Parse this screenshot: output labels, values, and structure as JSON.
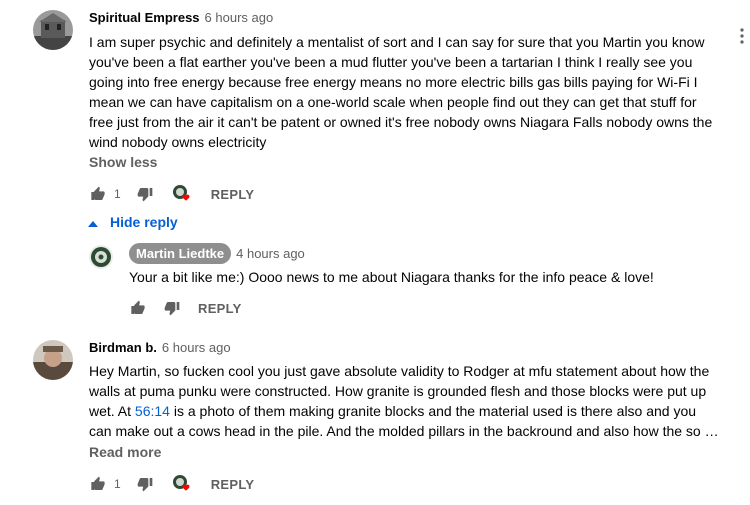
{
  "comments": [
    {
      "author": "Spiritual Empress",
      "time": "6 hours ago",
      "text": "I am super psychic and definitely a mentalist of sort and I can say for sure that you Martin you know you've been a flat earther you've been a mud flutter you've been a tartarian I think I really see you going into free energy because free energy means no more electric bills gas bills paying for Wi-Fi I mean we can have capitalism on a one-world scale when people find out they can get that stuff for free just from the air it can't be patent or owned it's free nobody owns Niagara Falls nobody owns the wind nobody owns electricity",
      "expand_label": "Show less",
      "likes": "1",
      "reply_label": "REPLY",
      "hide_replies_label": "Hide reply"
    },
    {
      "author": "Martin Liedtke",
      "time": "4 hours ago",
      "text": "Your a bit like me:) Oooo news to me about Niagara thanks for the info peace & love!",
      "reply_label": "REPLY"
    },
    {
      "author": "Birdman b.",
      "time": "6 hours ago",
      "text_before": "Hey Martin, so fucken cool you just gave absolute validity to Rodger at mfu statement about how the walls at puma punku were constructed. How granite is grounded flesh and those blocks were put up wet. At ",
      "timestamp_link": "56:14",
      "text_after": " is a photo of them making granite blocks and the material used is there also and you can make out a cows head in the pile. And the molded pillars in the backround and also how the so …",
      "expand_label": "Read more",
      "likes": "1",
      "reply_label": "REPLY"
    }
  ],
  "icons": {
    "like": "thumb-up-icon",
    "dislike": "thumb-down-icon",
    "heart": "creator-heart-icon",
    "caret": "caret-up-icon",
    "menu": "more-vertical-icon"
  },
  "colors": {
    "link": "#065fd4",
    "heart": "#ff0000",
    "secondary_text": "#606060",
    "creator_chip": "#8f8f8f"
  }
}
